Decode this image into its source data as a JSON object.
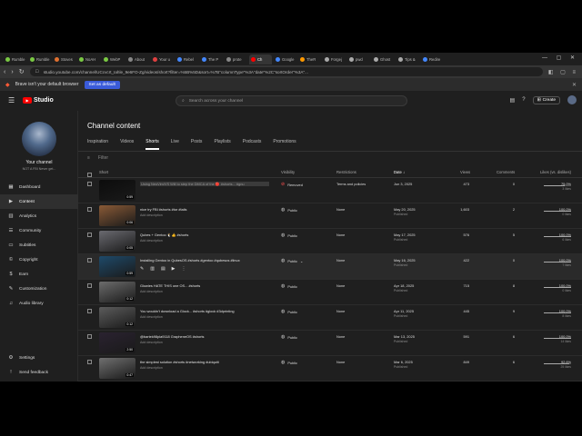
{
  "browser": {
    "tabs": [
      {
        "label": "Rumble",
        "color": "#7ac943"
      },
      {
        "label": "Rumble",
        "color": "#7ac943"
      },
      {
        "label": "Stoves",
        "color": "#e07030"
      },
      {
        "label": "NoAH",
        "color": "#7ac943"
      },
      {
        "label": "WebP",
        "color": "#7ac943"
      },
      {
        "label": "About",
        "color": "#888888"
      },
      {
        "label": "Your u",
        "color": "#e04040"
      },
      {
        "label": "Rebel",
        "color": "#4488ff"
      },
      {
        "label": "The P",
        "color": "#4488ff"
      },
      {
        "label": "prote",
        "color": "#888888"
      },
      {
        "label": "Ch",
        "color": "#ff0000",
        "active": true
      },
      {
        "label": "Google",
        "color": "#4488ff"
      },
      {
        "label": "TheR",
        "color": "#ff9900"
      },
      {
        "label": "Forgej",
        "color": "#aaaaaa"
      },
      {
        "label": "pwd",
        "color": "#aaaaaa"
      },
      {
        "label": "Ghost",
        "color": "#aaaaaa"
      },
      {
        "label": "Tips &",
        "color": "#aaaaaa"
      },
      {
        "label": "Redire",
        "color": "#4488ff"
      }
    ],
    "url": "studio.youtube.com/channel/UCcvcrt_Iahle_9e6FO-Zg/videos/short?filter=%5B%5D&sort=%7B\"columnType\"%3A\"date\"%2C\"sortOrder\"%3A\"...",
    "notice_text": "Brave isn't your default browser",
    "notice_button": "Set as default"
  },
  "app": {
    "logo_text": "Studio",
    "search_placeholder": "Search across your channel",
    "create_label": "Create",
    "channel_name": "Your channel",
    "channel_sub": "NOT A FBI Never get...",
    "nav": [
      {
        "label": "Dashboard",
        "icon": "dashboard-icon",
        "glyph": "▦"
      },
      {
        "label": "Content",
        "icon": "content-icon",
        "glyph": "▶",
        "active": true
      },
      {
        "label": "Analytics",
        "icon": "analytics-icon",
        "glyph": "▥"
      },
      {
        "label": "Community",
        "icon": "community-icon",
        "glyph": "☰"
      },
      {
        "label": "Subtitles",
        "icon": "subtitles-icon",
        "glyph": "▭"
      },
      {
        "label": "Copyright",
        "icon": "copyright-icon",
        "glyph": "©"
      },
      {
        "label": "Earn",
        "icon": "earn-icon",
        "glyph": "$"
      },
      {
        "label": "Customization",
        "icon": "customization-icon",
        "glyph": "✎"
      },
      {
        "label": "Audio library",
        "icon": "audio-library-icon",
        "glyph": "♫"
      }
    ],
    "nav_bottom": [
      {
        "label": "Settings",
        "icon": "settings-icon",
        "glyph": "⚙"
      },
      {
        "label": "Send feedback",
        "icon": "feedback-icon",
        "glyph": "!"
      }
    ],
    "page_title": "Channel content",
    "tabs": [
      "Inspiration",
      "Videos",
      "Shorts",
      "Live",
      "Posts",
      "Playlists",
      "Podcasts",
      "Promotions"
    ],
    "active_tab": "Shorts",
    "filter_label": "Filter",
    "columns": {
      "short": "Short",
      "visibility": "Visibility",
      "restrictions": "Restrictions",
      "date": "Date ↓",
      "views": "Views",
      "comments": "Comments",
      "likes": "Likes (vs. dislikes)"
    }
  },
  "rows": [
    {
      "title": "Using NeoVim/VS Will to step the DMCA of the 🔴 #shorts... #gnu",
      "desc": "",
      "removed": true,
      "visibility": "Removed",
      "restrictions": "Terms and policies",
      "date": "Jun 3, 2025",
      "status": "",
      "views": "473",
      "comments": "0",
      "likes": "75.0%",
      "likes_sub": "3 likes",
      "like_frac": 0.75,
      "duration": "0:59",
      "thumb_color": "#0c0c0c"
    },
    {
      "title": "nice try FBI #shorts #tor #tails",
      "desc": "Add description",
      "visibility": "Public",
      "restrictions": "None",
      "date": "May 20, 2025",
      "status": "Published",
      "views": "1,603",
      "comments": "2",
      "likes": "100.0%",
      "likes_sub": "0 likes",
      "like_frac": 1.0,
      "duration": "0:06",
      "thumb_color": "#8a5a36"
    },
    {
      "title": "Qubes + Gentoo 🐧👍 #shorts",
      "desc": "Add description",
      "visibility": "Public",
      "restrictions": "None",
      "date": "May 17, 2025",
      "status": "Published",
      "views": "576",
      "comments": "5",
      "likes": "100.0%",
      "likes_sub": "6 likes",
      "like_frac": 1.0,
      "duration": "0:05",
      "thumb_color": "#6a6a70"
    },
    {
      "title": "Installing Gentoo in QubesOS #shorts #gentoo #qubesos #linux",
      "desc": "",
      "hover": true,
      "visibility": "Public",
      "restrictions": "None",
      "date": "May 16, 2025",
      "status": "Published",
      "views": "422",
      "comments": "0",
      "likes": "100.0%",
      "likes_sub": "7 likes",
      "like_frac": 1.0,
      "duration": "0:59",
      "thumb_color": "#1e4a6a"
    },
    {
      "title": "Glowies HATE THIS one OS... #shorts",
      "desc": "Add description",
      "visibility": "Public",
      "restrictions": "None",
      "date": "Apr 18, 2025",
      "status": "Published",
      "views": "715",
      "comments": "8",
      "likes": "100.0%",
      "likes_sub": "0 likes",
      "like_frac": 1.0,
      "duration": "0:12",
      "thumb_color": "#6c6c6c"
    },
    {
      "title": "You wouldn't download a Glock... #shorts #glock #3dprinting",
      "desc": "Add description",
      "visibility": "Public",
      "restrictions": "None",
      "date": "Apr 11, 2025",
      "status": "Published",
      "views": "445",
      "comments": "9",
      "likes": "100.0%",
      "likes_sub": "8 likes",
      "like_frac": 1.0,
      "duration": "0:12",
      "thumb_color": "#5c5c5c"
    },
    {
      "title": "@bartek98pla9118 GrapheneOS #shorts",
      "desc": "Add description",
      "visibility": "Public",
      "restrictions": "None",
      "date": "Mar 13, 2025",
      "status": "Published",
      "views": "591",
      "comments": "6",
      "likes": "100.0%",
      "likes_sub": "14 likes",
      "like_frac": 1.0,
      "duration": "2:50",
      "thumb_color": "#2a2230"
    },
    {
      "title": "the simplest solution #shorts #networking #ubiquiti",
      "desc": "Add description",
      "visibility": "Public",
      "restrictions": "None",
      "date": "Mar 6, 2025",
      "status": "Published",
      "views": "849",
      "comments": "6",
      "likes": "92.6%",
      "likes_sub": "25 likes",
      "like_frac": 0.926,
      "duration": "0:47",
      "thumb_color": "#707070"
    }
  ]
}
